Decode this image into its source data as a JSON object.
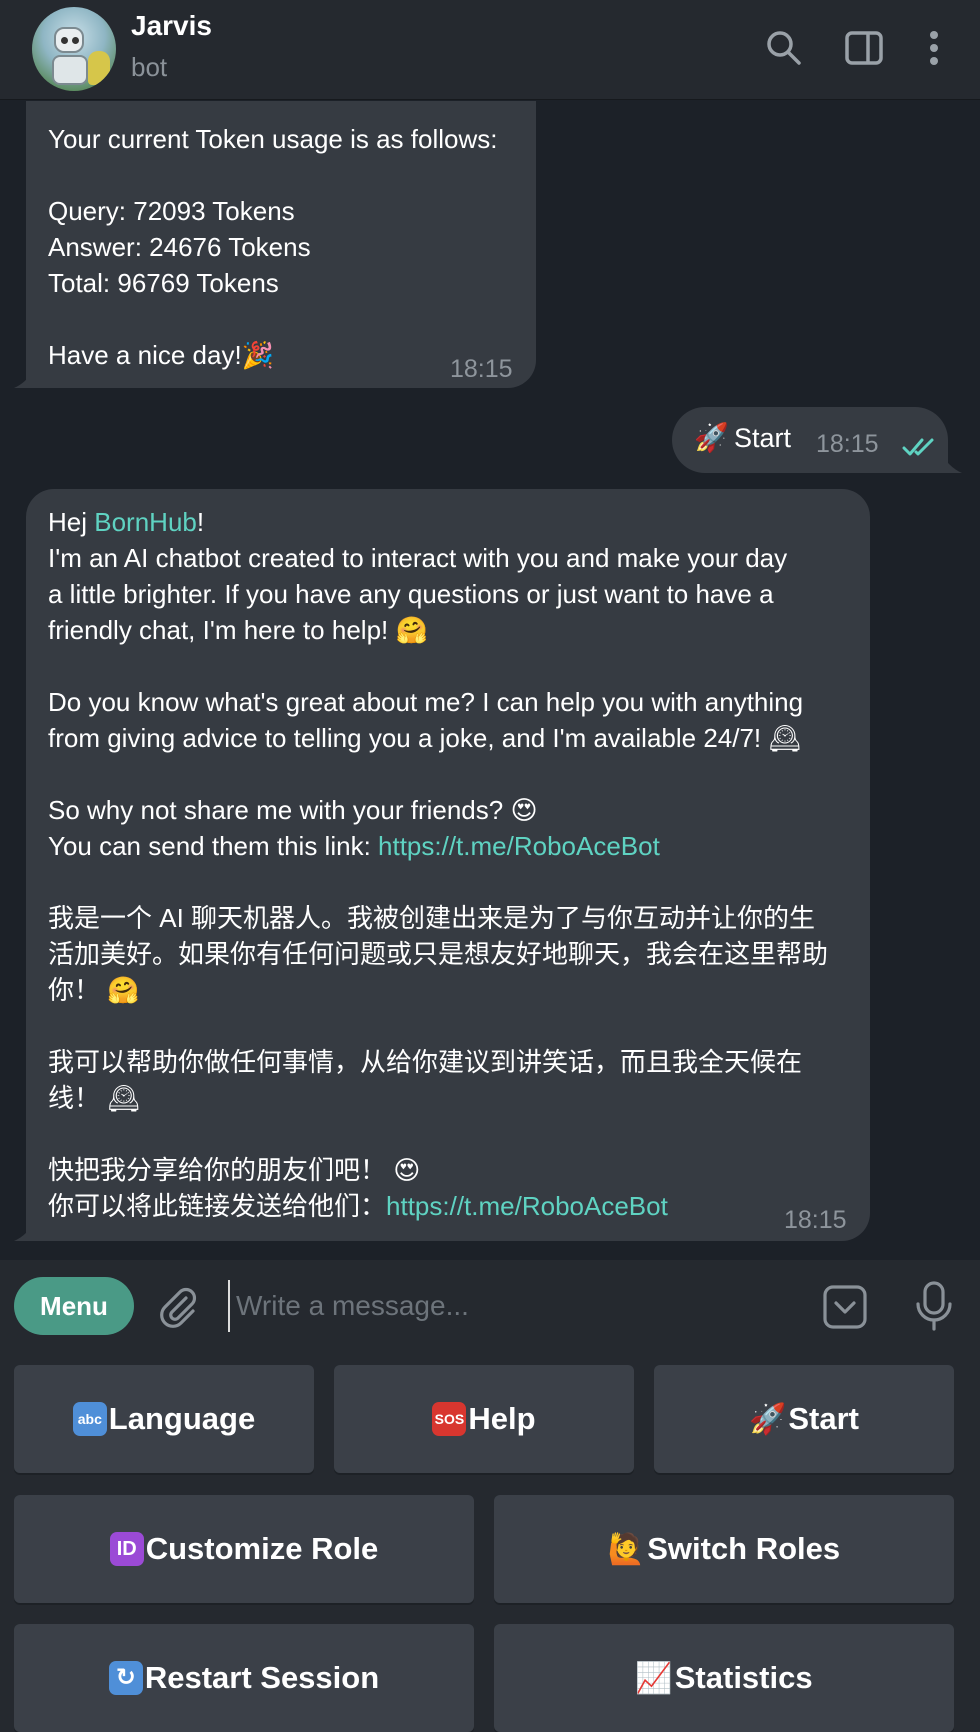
{
  "header": {
    "title": "Jarvis",
    "subtitle": "bot",
    "icons": [
      "search-icon",
      "sidebar-toggle-icon",
      "more-vertical-icon"
    ]
  },
  "messages": {
    "token": {
      "line1": "Your current Token usage is as follows:",
      "query": "Query: 72093 Tokens",
      "answer": "Answer: 24676 Tokens",
      "total": "Total: 96769 Tokens",
      "closing": "Have a nice day!",
      "closing_emoji": "🎉",
      "time": "18:15"
    },
    "outgoing": {
      "emoji": "🚀",
      "text": "Start",
      "time": "18:15",
      "status": "read"
    },
    "welcome": {
      "greet": "Hej ",
      "name": "BornHub",
      "greet_end": "!",
      "p1_l1": "I'm an AI chatbot created to interact with you and make your day",
      "p1_l2": "a little brighter. If you have any questions or just want to have a",
      "p1_l3": "friendly chat, I'm here to help! ",
      "p1_emoji": "🤗",
      "p2_l1": "Do you know what's great about me? I can help you with anything",
      "p2_l2": "from giving advice to telling you a joke, and I'm available 24/7! ",
      "p2_emoji": "🕰",
      "p3_l1": "So why not share me with your friends? ",
      "p3_emoji": "😍",
      "p3_l2": "You can send them this link: ",
      "link": "https://t.me/RoboAceBot",
      "cn1_l1": "我是一个 AI 聊天机器人。我被创建出来是为了与你互动并让你的生",
      "cn1_l2": "活加美好。如果你有任何问题或只是想友好地聊天，我会在这里帮助",
      "cn1_l3": "你！ ",
      "cn1_emoji": "🤗",
      "cn2_l1": "我可以帮助你做任何事情，从给你建议到讲笑话，而且我全天候在",
      "cn2_l2": "线！ ",
      "cn2_emoji": "🕰",
      "cn3_l1": "快把我分享给你的朋友们吧！ ",
      "cn3_emoji": "😍",
      "cn3_l2": "你可以将此链接发送给他们：",
      "time": "18:15"
    }
  },
  "composer": {
    "menu_label": "Menu",
    "placeholder": "Write a message..."
  },
  "keyboard": {
    "language": {
      "icon": "abc",
      "label": "Language"
    },
    "help": {
      "icon": "SOS",
      "label": "Help"
    },
    "start": {
      "icon": "🚀",
      "label": "Start"
    },
    "customize": {
      "icon": "ID",
      "label": "Customize Role"
    },
    "switch": {
      "icon": "🙋",
      "label": "Switch Roles"
    },
    "restart": {
      "icon": "↻",
      "label": "Restart Session"
    },
    "statistics": {
      "icon": "📈",
      "label": "Statistics"
    }
  },
  "colors": {
    "background": "#1c2128",
    "bubble": "#363b42",
    "link": "#5fd3c2",
    "menu_button": "#4a9a86",
    "read_check": "#5fd3c2"
  }
}
